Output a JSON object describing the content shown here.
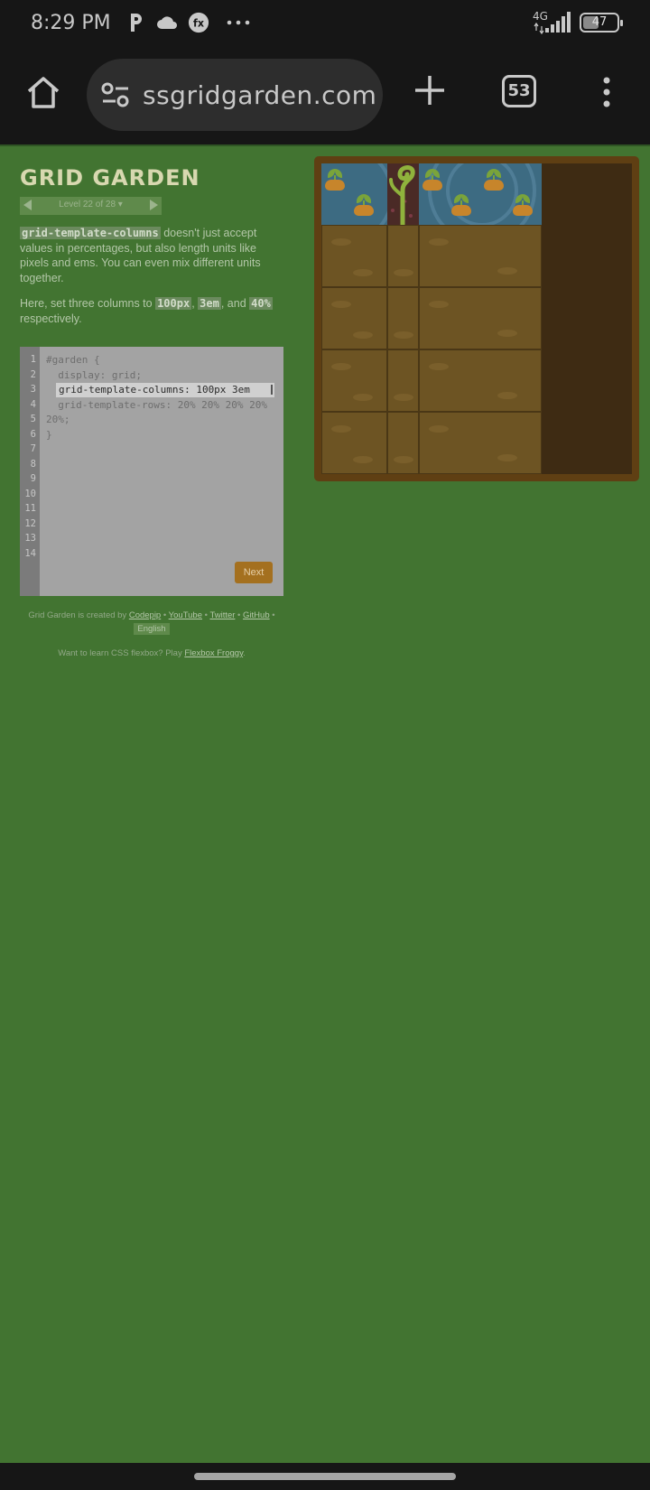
{
  "status_bar": {
    "time": "8:29 PM",
    "network": "4G",
    "battery": "47",
    "battery_fraction": 0.47,
    "icons": [
      "p-icon",
      "cloud-icon",
      "fx-icon",
      "more-notifications-icon",
      "signal-icon",
      "battery-icon"
    ]
  },
  "browser": {
    "url": "ssgridgarden.com",
    "tab_count": "53",
    "icons": [
      "home-icon",
      "site-settings-icon",
      "new-tab-icon",
      "tab-switcher-icon",
      "menu-icon"
    ]
  },
  "game": {
    "title": "GRID GARDEN",
    "level_label": "Level 22 of 28",
    "level_caret": "▾",
    "instruction1": {
      "code": "grid-template-columns",
      "text": " doesn't just accept values in percentages, but also length units like pixels and ems. You can even mix different units together."
    },
    "instruction2": {
      "prefix": "Here, set three columns to ",
      "code1": "100px",
      "sep1": ", ",
      "code2": "3em",
      "sep2": ", and ",
      "code3": "40%",
      "suffix": " respectively."
    },
    "editor": {
      "line_numbers": [
        "1",
        "2",
        "3",
        "4",
        "5",
        "6",
        "7",
        "8",
        "9",
        "10",
        "11",
        "12",
        "13",
        "14"
      ],
      "line1": "#garden {",
      "line2": "  display: grid;",
      "input_value": "grid-template-columns: 100px 3em ",
      "line4": "  grid-template-rows: 20% 20% 20% 20%",
      "line5": "20%;",
      "line6": "}",
      "next_label": "Next"
    },
    "footer": {
      "created_by": "Grid Garden is created by ",
      "codepip": "Codepip",
      "youtube": "YouTube",
      "twitter": "Twitter",
      "github": "GitHub",
      "bullet": " • ",
      "language": "English",
      "flexbox_prefix": "Want to learn CSS flexbox? Play ",
      "flexbox_link": "Flexbox Froggy",
      "flexbox_suffix": "."
    }
  },
  "colors": {
    "page_green": "#427431",
    "water": "#3d6b82",
    "soil": "#6d5423",
    "carrot": "#c7852b",
    "next_button": "#a4701f"
  }
}
